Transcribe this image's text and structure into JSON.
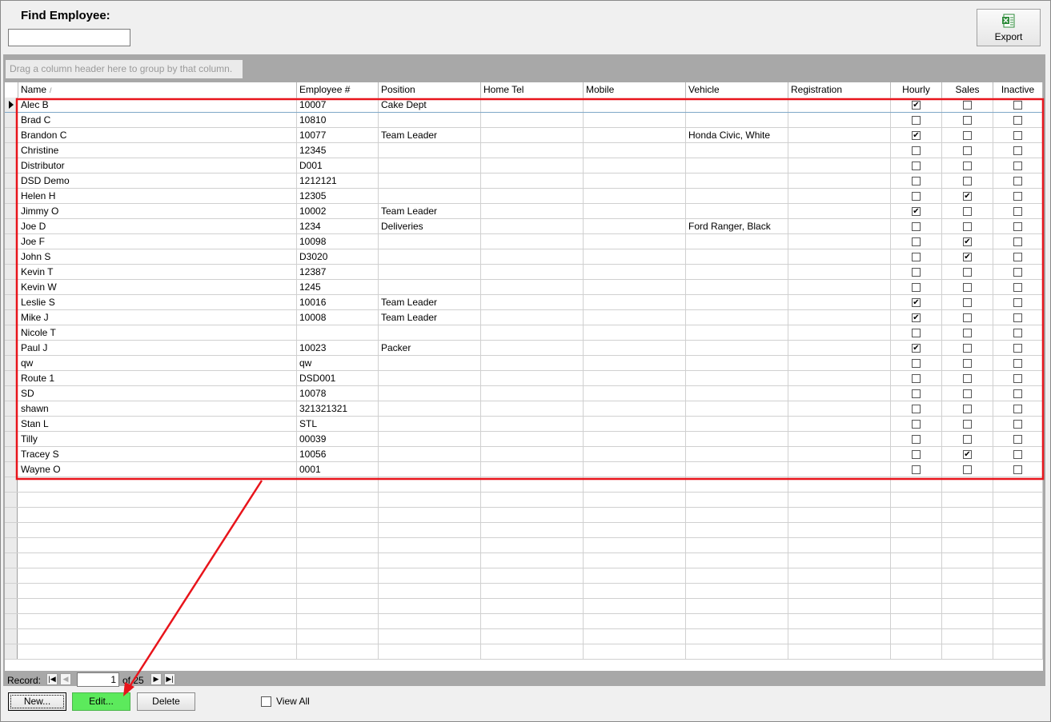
{
  "find": {
    "label": "Find Employee:",
    "value": ""
  },
  "export": {
    "label": "Export",
    "icon": "excel-export-icon"
  },
  "group_panel": {
    "hint": "Drag a column header here to group by that column."
  },
  "grid": {
    "columns": [
      {
        "key": "name",
        "label": "Name",
        "sort": "ascending"
      },
      {
        "key": "emp",
        "label": "Employee #"
      },
      {
        "key": "pos",
        "label": "Position"
      },
      {
        "key": "home",
        "label": "Home Tel"
      },
      {
        "key": "mobile",
        "label": "Mobile"
      },
      {
        "key": "vehicle",
        "label": "Vehicle"
      },
      {
        "key": "reg",
        "label": "Registration"
      },
      {
        "key": "hourly",
        "label": "Hourly"
      },
      {
        "key": "sales",
        "label": "Sales"
      },
      {
        "key": "inactive",
        "label": "Inactive"
      }
    ],
    "sort_indicator": "/",
    "rows": [
      {
        "name": "Alec B",
        "emp": "10007",
        "pos": "Cake Dept",
        "vehicle": "",
        "hourly": true,
        "sales": false,
        "inactive": false
      },
      {
        "name": "Brad C",
        "emp": "10810",
        "pos": "",
        "vehicle": "",
        "hourly": false,
        "sales": false,
        "inactive": false
      },
      {
        "name": "Brandon C",
        "emp": "10077",
        "pos": "Team Leader",
        "vehicle": "Honda Civic, White",
        "hourly": true,
        "sales": false,
        "inactive": false
      },
      {
        "name": "Christine",
        "emp": "12345",
        "pos": "",
        "vehicle": "",
        "hourly": false,
        "sales": false,
        "inactive": false
      },
      {
        "name": "Distributor",
        "emp": "D001",
        "pos": "",
        "vehicle": "",
        "hourly": false,
        "sales": false,
        "inactive": false
      },
      {
        "name": "DSD Demo",
        "emp": "1212121",
        "pos": "",
        "vehicle": "",
        "hourly": false,
        "sales": false,
        "inactive": false
      },
      {
        "name": "Helen H",
        "emp": "12305",
        "pos": "",
        "vehicle": "",
        "hourly": false,
        "sales": true,
        "inactive": false
      },
      {
        "name": "Jimmy O",
        "emp": "10002",
        "pos": "Team Leader",
        "vehicle": "",
        "hourly": true,
        "sales": false,
        "inactive": false
      },
      {
        "name": "Joe D",
        "emp": "1234",
        "pos": "Deliveries",
        "vehicle": "Ford Ranger, Black",
        "hourly": false,
        "sales": false,
        "inactive": false
      },
      {
        "name": "Joe F",
        "emp": "10098",
        "pos": "",
        "vehicle": "",
        "hourly": false,
        "sales": true,
        "inactive": false
      },
      {
        "name": "John S",
        "emp": "D3020",
        "pos": "",
        "vehicle": "",
        "hourly": false,
        "sales": true,
        "inactive": false
      },
      {
        "name": "Kevin T",
        "emp": "12387",
        "pos": "",
        "vehicle": "",
        "hourly": false,
        "sales": false,
        "inactive": false
      },
      {
        "name": "Kevin W",
        "emp": "1245",
        "pos": "",
        "vehicle": "",
        "hourly": false,
        "sales": false,
        "inactive": false
      },
      {
        "name": "Leslie S",
        "emp": "10016",
        "pos": "Team Leader",
        "vehicle": "",
        "hourly": true,
        "sales": false,
        "inactive": false
      },
      {
        "name": "Mike J",
        "emp": "10008",
        "pos": "Team Leader",
        "vehicle": "",
        "hourly": true,
        "sales": false,
        "inactive": false
      },
      {
        "name": "Nicole T",
        "emp": "",
        "pos": "",
        "vehicle": "",
        "hourly": false,
        "sales": false,
        "inactive": false
      },
      {
        "name": "Paul J",
        "emp": "10023",
        "pos": "Packer",
        "vehicle": "",
        "hourly": true,
        "sales": false,
        "inactive": false
      },
      {
        "name": "qw",
        "emp": "qw",
        "pos": "",
        "vehicle": "",
        "hourly": false,
        "sales": false,
        "inactive": false
      },
      {
        "name": "Route 1",
        "emp": "DSD001",
        "pos": "",
        "vehicle": "",
        "hourly": false,
        "sales": false,
        "inactive": false
      },
      {
        "name": "SD",
        "emp": "10078",
        "pos": "",
        "vehicle": "",
        "hourly": false,
        "sales": false,
        "inactive": false
      },
      {
        "name": "shawn",
        "emp": "321321321",
        "pos": "",
        "vehicle": "",
        "hourly": false,
        "sales": false,
        "inactive": false
      },
      {
        "name": "Stan L",
        "emp": "STL",
        "pos": "",
        "vehicle": "",
        "hourly": false,
        "sales": false,
        "inactive": false
      },
      {
        "name": "Tilly",
        "emp": "00039",
        "pos": "",
        "vehicle": "",
        "hourly": false,
        "sales": false,
        "inactive": false
      },
      {
        "name": "Tracey S",
        "emp": "10056",
        "pos": "",
        "vehicle": "",
        "hourly": false,
        "sales": true,
        "inactive": false
      },
      {
        "name": "Wayne O",
        "emp": "0001",
        "pos": "",
        "vehicle": "",
        "hourly": false,
        "sales": false,
        "inactive": false
      }
    ],
    "current_row": 0,
    "check_mark": "✔"
  },
  "record_nav": {
    "label": "Record:",
    "current": "1",
    "of_text": "of 25"
  },
  "buttons": {
    "new": "New...",
    "edit": "Edit...",
    "delete": "Delete"
  },
  "view_all": {
    "label": "View All",
    "checked": false
  },
  "annotation": {
    "highlight_color": "#e8141b",
    "edit_color": "#5cea5c"
  }
}
